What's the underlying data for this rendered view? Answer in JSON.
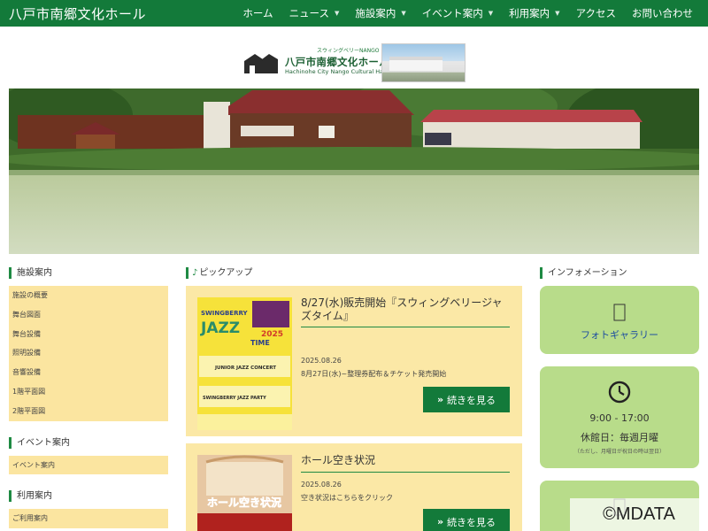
{
  "header": {
    "site_title": "八戸市南郷文化ホール",
    "nav": [
      {
        "label": "ホーム",
        "dropdown": false
      },
      {
        "label": "ニュース",
        "dropdown": true
      },
      {
        "label": "施設案内",
        "dropdown": true
      },
      {
        "label": "イベント案内",
        "dropdown": true
      },
      {
        "label": "利用案内",
        "dropdown": true
      },
      {
        "label": "アクセス",
        "dropdown": false
      },
      {
        "label": "お問い合わせ",
        "dropdown": false
      }
    ]
  },
  "logo": {
    "tagline": "スウィングベリーNANGO",
    "name": "八戸市南郷文化ホール",
    "name_en": "Hachinohe City Nango Cultural Hall"
  },
  "left": {
    "sections": [
      {
        "heading": "施設案内",
        "items": [
          "施設の概要",
          "舞台図面",
          "舞台設備",
          "照明設備",
          "音響設備",
          "1階平面図",
          "2階平面図"
        ]
      },
      {
        "heading": "イベント案内",
        "items": [
          "イベント案内"
        ]
      },
      {
        "heading": "利用案内",
        "items": [
          "ご利用案内"
        ]
      }
    ]
  },
  "pickup": {
    "heading": "ピックアップ",
    "posts": [
      {
        "title": "8/27(水)販売開始『スウィングベリージャズタイム』",
        "date": "2025.08.26",
        "desc": "8月27日(水)~整理券配布＆チケット発売開始",
        "more": "続きを見る",
        "poster_lines": [
          "SWINGBERRY",
          "JAZZ",
          "2025",
          "TIME",
          "JUNIOR JAZZ CONCERT",
          "SWINGBERRY JAZZ PARTY"
        ]
      },
      {
        "title": "ホール空き状況",
        "date": "2025.08.26",
        "desc": "空き状況はこちらをクリック",
        "more": "続きを見る",
        "image_caption": "ホール空き状況"
      }
    ]
  },
  "info": {
    "heading": "インフォメーション",
    "gallery_label": "フォトギャラリー",
    "hours": "9:00 - 17:00",
    "closed": "休館日：毎週月曜",
    "note": "（ただし、月曜日が祝日の時は翌日）"
  },
  "watermark": "©MDATA",
  "colors": {
    "brand_green": "#137a3a",
    "menu_yellow": "#fbe5a0",
    "info_green": "#b8dc8a"
  }
}
